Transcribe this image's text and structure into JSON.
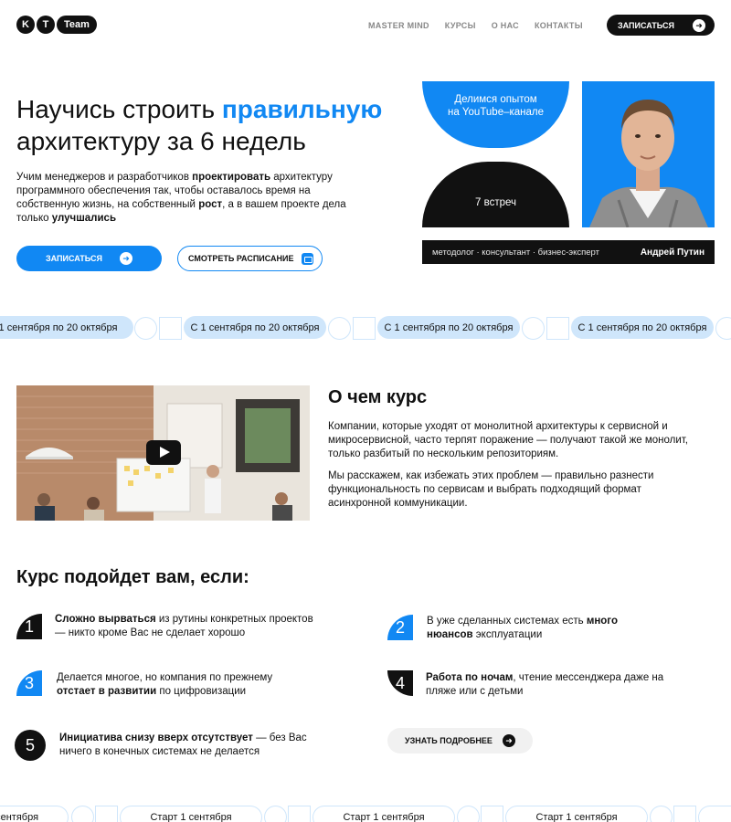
{
  "header": {
    "logo": {
      "k": "K",
      "t": "T",
      "team": "Team"
    },
    "nav": [
      "MASTER MIND",
      "КУРСЫ",
      "О НАС",
      "КОНТАКТЫ"
    ],
    "cta_label": "ЗАПИСАТЬСЯ"
  },
  "hero": {
    "title_before": "Научись строить ",
    "title_accent": "правильную",
    "title_after": "архитектуру за 6 недель",
    "desc": [
      "Учим менеджеров и разработчиков ",
      "проектировать",
      " архитектуру программного обеспечения так, чтобы оставалось время на собственную жизнь, на собственный ",
      "рост",
      ", а в вашем проекте дела только ",
      "улучшались"
    ],
    "btn_primary": "ЗАПИСАТЬСЯ",
    "btn_secondary": "СМОТРЕТЬ РАСПИСАНИЕ",
    "bubble_top_line1": "Делимся опытом",
    "bubble_top_line2": "на YouTube–канале",
    "bubble_bottom": "7 встреч",
    "caption_role": "методолог · консультант · бизнес-эксперт",
    "caption_name": "Андрей Путин"
  },
  "marquee_top": {
    "pill_text": "С 1 сентября по 20 октября",
    "pill_partial": "С 1 сентября по 20 октября"
  },
  "about": {
    "title": "О чем курс",
    "p1": "Компании, которые уходят от монолитной архитектуры к сервисной и микросервисной, часто терпят поражение — получают такой же монолит, только разбитый по нескольким репозиториям.",
    "p2": "Мы расскажем, как избежать этих проблем — правильно разнести функциональность по сервисам и выбрать подходящий формат асинхронной коммуникации."
  },
  "fit": {
    "title": "Курс подойдет вам, если:",
    "items": [
      {
        "num": "1",
        "bold": "Сложно вырваться",
        "rest": " из рутины конкретных проектов — никто кроме Вас не сделает хорошо"
      },
      {
        "num": "2",
        "pre": "В уже сделанных системах есть ",
        "bold": "много нюансов",
        "rest": " эксплуатации"
      },
      {
        "num": "3",
        "pre": "Делается многое, но компания по прежнему ",
        "bold": "отстает в развитии",
        "rest": " по цифровизации"
      },
      {
        "num": "4",
        "bold": "Работа по ночам",
        "rest": ", чтение мессенджера даже на пляже или с детьми"
      },
      {
        "num": "5",
        "bold": "Инициатива снизу вверх отсутствует",
        "rest": " — без Вас ничего в конечных системах не делается"
      }
    ],
    "more_btn": "УЗНАТЬ ПОДРОБНЕЕ"
  },
  "marquee_bottom": {
    "pill_text": "Старт 1 сентября",
    "pill_partial": "Старт 1 сентября"
  },
  "colors": {
    "accent": "#1188f3",
    "light": "#cfe6fb",
    "dark": "#111111"
  },
  "icons": {
    "arrow": "arrow-right-icon",
    "calendar": "calendar-icon",
    "play": "play-icon"
  }
}
